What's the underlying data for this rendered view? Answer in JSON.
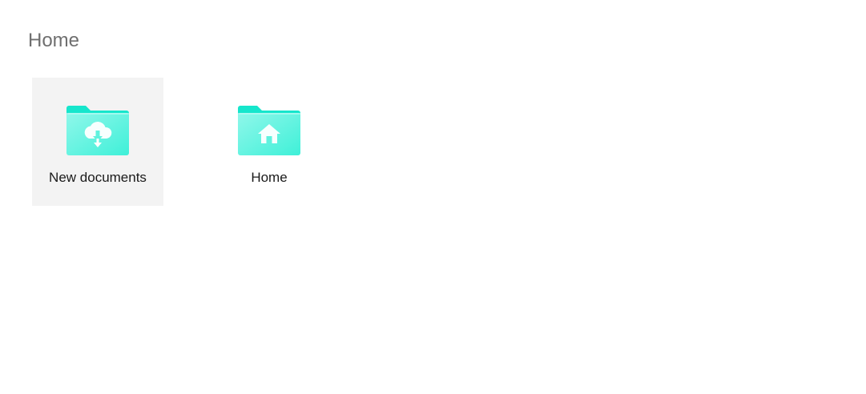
{
  "header": {
    "title": "Home"
  },
  "folders": [
    {
      "label": "New documents",
      "icon": "cloud-download-folder-icon",
      "selected": true
    },
    {
      "label": "Home",
      "icon": "home-folder-icon",
      "selected": false
    }
  ],
  "colors": {
    "folder_back": "#16e6cc",
    "folder_front": "#7af5e6",
    "selected_bg": "#f3f3f3",
    "title_text": "#6f6f6f"
  }
}
